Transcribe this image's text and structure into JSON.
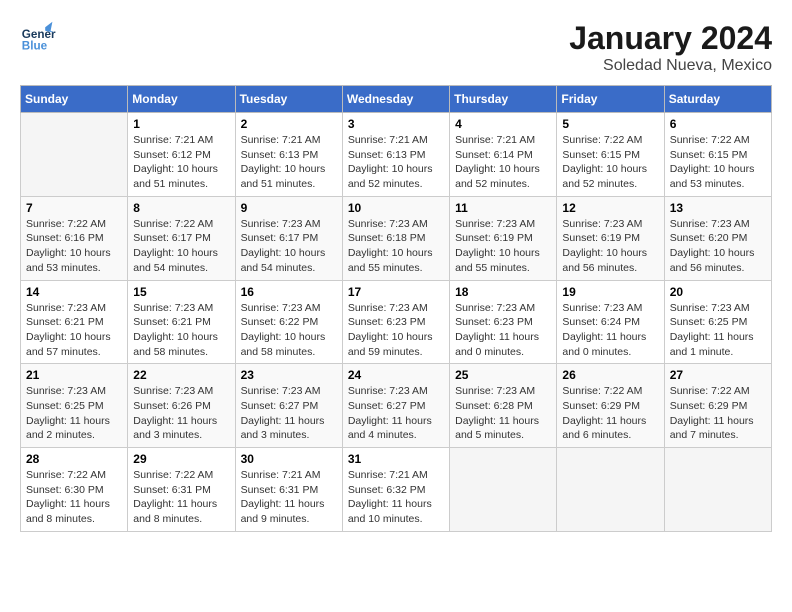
{
  "logo": {
    "general": "General",
    "blue": "Blue"
  },
  "title": "January 2024",
  "subtitle": "Soledad Nueva, Mexico",
  "days_of_week": [
    "Sunday",
    "Monday",
    "Tuesday",
    "Wednesday",
    "Thursday",
    "Friday",
    "Saturday"
  ],
  "weeks": [
    [
      {
        "num": "",
        "info": ""
      },
      {
        "num": "1",
        "info": "Sunrise: 7:21 AM\nSunset: 6:12 PM\nDaylight: 10 hours\nand 51 minutes."
      },
      {
        "num": "2",
        "info": "Sunrise: 7:21 AM\nSunset: 6:13 PM\nDaylight: 10 hours\nand 51 minutes."
      },
      {
        "num": "3",
        "info": "Sunrise: 7:21 AM\nSunset: 6:13 PM\nDaylight: 10 hours\nand 52 minutes."
      },
      {
        "num": "4",
        "info": "Sunrise: 7:21 AM\nSunset: 6:14 PM\nDaylight: 10 hours\nand 52 minutes."
      },
      {
        "num": "5",
        "info": "Sunrise: 7:22 AM\nSunset: 6:15 PM\nDaylight: 10 hours\nand 52 minutes."
      },
      {
        "num": "6",
        "info": "Sunrise: 7:22 AM\nSunset: 6:15 PM\nDaylight: 10 hours\nand 53 minutes."
      }
    ],
    [
      {
        "num": "7",
        "info": "Sunrise: 7:22 AM\nSunset: 6:16 PM\nDaylight: 10 hours\nand 53 minutes."
      },
      {
        "num": "8",
        "info": "Sunrise: 7:22 AM\nSunset: 6:17 PM\nDaylight: 10 hours\nand 54 minutes."
      },
      {
        "num": "9",
        "info": "Sunrise: 7:23 AM\nSunset: 6:17 PM\nDaylight: 10 hours\nand 54 minutes."
      },
      {
        "num": "10",
        "info": "Sunrise: 7:23 AM\nSunset: 6:18 PM\nDaylight: 10 hours\nand 55 minutes."
      },
      {
        "num": "11",
        "info": "Sunrise: 7:23 AM\nSunset: 6:19 PM\nDaylight: 10 hours\nand 55 minutes."
      },
      {
        "num": "12",
        "info": "Sunrise: 7:23 AM\nSunset: 6:19 PM\nDaylight: 10 hours\nand 56 minutes."
      },
      {
        "num": "13",
        "info": "Sunrise: 7:23 AM\nSunset: 6:20 PM\nDaylight: 10 hours\nand 56 minutes."
      }
    ],
    [
      {
        "num": "14",
        "info": "Sunrise: 7:23 AM\nSunset: 6:21 PM\nDaylight: 10 hours\nand 57 minutes."
      },
      {
        "num": "15",
        "info": "Sunrise: 7:23 AM\nSunset: 6:21 PM\nDaylight: 10 hours\nand 58 minutes."
      },
      {
        "num": "16",
        "info": "Sunrise: 7:23 AM\nSunset: 6:22 PM\nDaylight: 10 hours\nand 58 minutes."
      },
      {
        "num": "17",
        "info": "Sunrise: 7:23 AM\nSunset: 6:23 PM\nDaylight: 10 hours\nand 59 minutes."
      },
      {
        "num": "18",
        "info": "Sunrise: 7:23 AM\nSunset: 6:23 PM\nDaylight: 11 hours\nand 0 minutes."
      },
      {
        "num": "19",
        "info": "Sunrise: 7:23 AM\nSunset: 6:24 PM\nDaylight: 11 hours\nand 0 minutes."
      },
      {
        "num": "20",
        "info": "Sunrise: 7:23 AM\nSunset: 6:25 PM\nDaylight: 11 hours\nand 1 minute."
      }
    ],
    [
      {
        "num": "21",
        "info": "Sunrise: 7:23 AM\nSunset: 6:25 PM\nDaylight: 11 hours\nand 2 minutes."
      },
      {
        "num": "22",
        "info": "Sunrise: 7:23 AM\nSunset: 6:26 PM\nDaylight: 11 hours\nand 3 minutes."
      },
      {
        "num": "23",
        "info": "Sunrise: 7:23 AM\nSunset: 6:27 PM\nDaylight: 11 hours\nand 3 minutes."
      },
      {
        "num": "24",
        "info": "Sunrise: 7:23 AM\nSunset: 6:27 PM\nDaylight: 11 hours\nand 4 minutes."
      },
      {
        "num": "25",
        "info": "Sunrise: 7:23 AM\nSunset: 6:28 PM\nDaylight: 11 hours\nand 5 minutes."
      },
      {
        "num": "26",
        "info": "Sunrise: 7:22 AM\nSunset: 6:29 PM\nDaylight: 11 hours\nand 6 minutes."
      },
      {
        "num": "27",
        "info": "Sunrise: 7:22 AM\nSunset: 6:29 PM\nDaylight: 11 hours\nand 7 minutes."
      }
    ],
    [
      {
        "num": "28",
        "info": "Sunrise: 7:22 AM\nSunset: 6:30 PM\nDaylight: 11 hours\nand 8 minutes."
      },
      {
        "num": "29",
        "info": "Sunrise: 7:22 AM\nSunset: 6:31 PM\nDaylight: 11 hours\nand 8 minutes."
      },
      {
        "num": "30",
        "info": "Sunrise: 7:21 AM\nSunset: 6:31 PM\nDaylight: 11 hours\nand 9 minutes."
      },
      {
        "num": "31",
        "info": "Sunrise: 7:21 AM\nSunset: 6:32 PM\nDaylight: 11 hours\nand 10 minutes."
      },
      {
        "num": "",
        "info": ""
      },
      {
        "num": "",
        "info": ""
      },
      {
        "num": "",
        "info": ""
      }
    ]
  ]
}
